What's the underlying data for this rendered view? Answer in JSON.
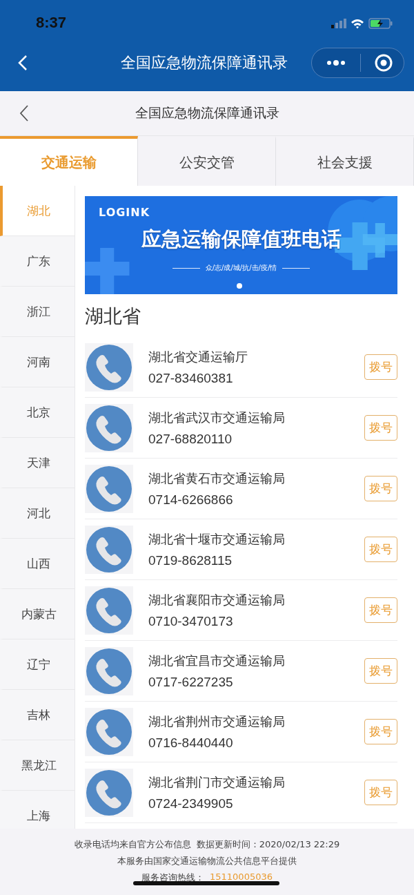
{
  "status_bar": {
    "time": "8:37"
  },
  "nav_bar": {
    "title": "全国应急物流保障通讯录"
  },
  "header": {
    "title": "全国应急物流保障通讯录"
  },
  "tabs": [
    {
      "label": "交通运输",
      "selected": true
    },
    {
      "label": "公安交管",
      "selected": false
    },
    {
      "label": "社会支援",
      "selected": false
    }
  ],
  "sidebar": {
    "items": [
      {
        "label": "湖北",
        "selected": true
      },
      {
        "label": "广东",
        "selected": false
      },
      {
        "label": "浙江",
        "selected": false
      },
      {
        "label": "河南",
        "selected": false
      },
      {
        "label": "北京",
        "selected": false
      },
      {
        "label": "天津",
        "selected": false
      },
      {
        "label": "河北",
        "selected": false
      },
      {
        "label": "山西",
        "selected": false
      },
      {
        "label": "内蒙古",
        "selected": false
      },
      {
        "label": "辽宁",
        "selected": false
      },
      {
        "label": "吉林",
        "selected": false
      },
      {
        "label": "黑龙江",
        "selected": false
      },
      {
        "label": "上海",
        "selected": false
      }
    ]
  },
  "banner": {
    "brand": "LOGINK",
    "title": "应急运输保障值班电话",
    "tagline": "众/志/成/城/抗/击/疫/情"
  },
  "section_title": "湖北省",
  "contacts": [
    {
      "name": "湖北省交通运输厅",
      "phone": "027-83460381",
      "action": "拨号"
    },
    {
      "name": "湖北省武汉市交通运输局",
      "phone": "027-68820110",
      "action": "拨号"
    },
    {
      "name": "湖北省黄石市交通运输局",
      "phone": "0714-6266866",
      "action": "拨号"
    },
    {
      "name": "湖北省十堰市交通运输局",
      "phone": "0719-8628115",
      "action": "拨号"
    },
    {
      "name": "湖北省襄阳市交通运输局",
      "phone": "0710-3470173",
      "action": "拨号"
    },
    {
      "name": "湖北省宜昌市交通运输局",
      "phone": "0717-6227235",
      "action": "拨号"
    },
    {
      "name": "湖北省荆州市交通运输局",
      "phone": "0716-8440440",
      "action": "拨号"
    },
    {
      "name": "湖北省荆门市交通运输局",
      "phone": "0724-2349905",
      "action": "拨号"
    }
  ],
  "footer": {
    "source": "收录电话均来自官方公布信息",
    "updated_label": "数据更新时间：",
    "updated": "2020/02/13 22:29",
    "provider": "本服务由国家交通运输物流公共信息平台提供",
    "hotline_label": "服务咨询热线：",
    "hotline": "15110005036"
  }
}
